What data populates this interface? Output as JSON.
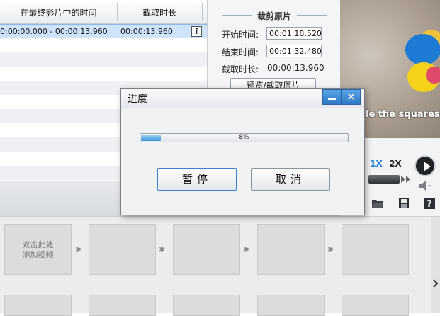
{
  "clip_table": {
    "header_time_in_movie": "在最终影片中的时间",
    "header_duration": "截取时长",
    "row": {
      "time_range": "0:00:00.000 - 00:00:13.960",
      "duration": "00:00:13.960",
      "info_icon": "i"
    }
  },
  "trim_panel": {
    "title": "裁剪原片",
    "start_label": "开始时间:",
    "start_value": "00:01:18.520",
    "end_label": "结束时间:",
    "end_value": "00:01:32.480",
    "duration_label": "截取时长:",
    "duration_value": "00:00:13.960",
    "preview_button": "预览/截取原片"
  },
  "preview": {
    "caption": "le the squares"
  },
  "player": {
    "speed_1x": "1X",
    "speed_2x": "2X",
    "icons": [
      "play-icon",
      "fast-forward-icon",
      "volume-icon",
      "open-folder-icon",
      "save-icon",
      "help-icon"
    ]
  },
  "storyboard": {
    "first_slot_text_line1": "双击此处",
    "first_slot_text_line2": "添加视频"
  },
  "dialog": {
    "title": "进度",
    "progress_percent": 8,
    "progress_text": "8%",
    "pause_button": "暂停",
    "cancel_button": "取消",
    "accent_color": "#3d95d6"
  }
}
